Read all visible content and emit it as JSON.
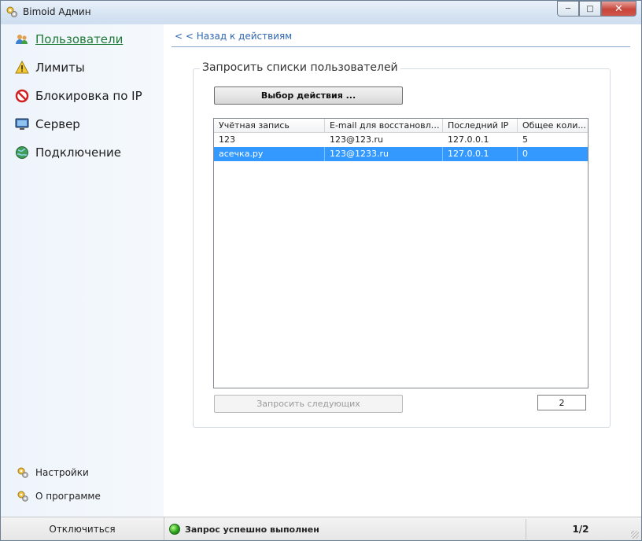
{
  "window": {
    "title": "Bimoid Админ"
  },
  "sidebar": {
    "items": [
      {
        "label": "Пользователи",
        "icon": "users-icon",
        "active": true
      },
      {
        "label": "Лимиты",
        "icon": "warning-icon"
      },
      {
        "label": "Блокировка по IP",
        "icon": "block-icon"
      },
      {
        "label": "Сервер",
        "icon": "monitor-icon"
      },
      {
        "label": "Подключение",
        "icon": "globe-icon"
      }
    ],
    "bottom": [
      {
        "label": "Настройки",
        "icon": "gears-icon"
      },
      {
        "label": "О программе",
        "icon": "gears-icon"
      }
    ]
  },
  "main": {
    "back_link": "< < Назад к действиям",
    "group_title": "Запросить списки пользователей",
    "action_button": "Выбор действия ...",
    "table": {
      "columns": [
        "Учётная запись",
        "E-mail для восстановлен...",
        "Последний IP",
        "Общее коли..."
      ],
      "rows": [
        [
          "123",
          "123@123.ru",
          "127.0.0.1",
          "5"
        ],
        [
          "асечка.ру",
          "123@1233.ru",
          "127.0.0.1",
          "0"
        ]
      ],
      "selected_row": 1
    },
    "next_button": "Запросить следующих",
    "page_field": "2"
  },
  "statusbar": {
    "disconnect": "Отключиться",
    "status": "Запрос успешно выполнен",
    "page": "1/2"
  },
  "colors": {
    "accent": "#3399ff",
    "active_nav": "#1f7a37",
    "link": "#2f67b0"
  }
}
